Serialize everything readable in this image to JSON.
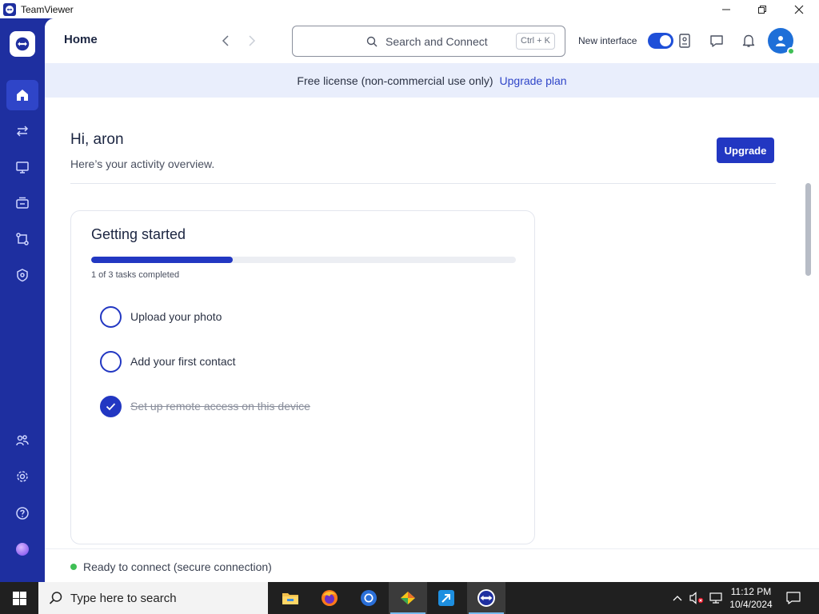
{
  "window": {
    "title": "TeamViewer",
    "minimize_icon": "minimize-icon",
    "restore_icon": "restore-icon",
    "close_icon": "close-icon"
  },
  "rail": {
    "items": [
      {
        "name": "home",
        "icon": "home-icon",
        "active": true
      },
      {
        "name": "remote-connect",
        "icon": "arrows-swap-icon"
      },
      {
        "name": "remote-support",
        "icon": "monitor-icon"
      },
      {
        "name": "devices",
        "icon": "device-group-icon"
      },
      {
        "name": "integrations",
        "icon": "nodes-icon"
      },
      {
        "name": "security",
        "icon": "shield-icon"
      },
      {
        "name": "contacts",
        "icon": "people-icon"
      },
      {
        "name": "settings",
        "icon": "gear-icon"
      },
      {
        "name": "help",
        "icon": "help-icon"
      },
      {
        "name": "assistant",
        "icon": "ai-orb-icon"
      }
    ]
  },
  "topbar": {
    "title": "Home",
    "search_placeholder": "Search and Connect",
    "search_shortcut": "Ctrl + K",
    "new_interface_label": "New interface",
    "new_interface_on": true
  },
  "banner": {
    "text": "Free license (non-commercial use only)",
    "link": "Upgrade plan"
  },
  "greeting": {
    "title": "Hi, aron",
    "subtitle": "Here’s your activity overview.",
    "upgrade_button": "Upgrade"
  },
  "getting_started": {
    "title": "Getting started",
    "progress_text": "1 of 3 tasks completed",
    "progress_fraction": 0.333,
    "tasks": [
      {
        "label": "Upload your photo",
        "done": false
      },
      {
        "label": "Add your first contact",
        "done": false
      },
      {
        "label": "Set up remote access on this device",
        "done": true
      }
    ]
  },
  "status": {
    "text": "Ready to connect (secure connection)"
  },
  "taskbar": {
    "search_placeholder": "Type here to search",
    "time": "11:12 PM",
    "date": "10/4/2024"
  },
  "colors": {
    "brand": "#1e2fa0",
    "accent": "#2237c2",
    "status_green": "#3fbf55"
  }
}
